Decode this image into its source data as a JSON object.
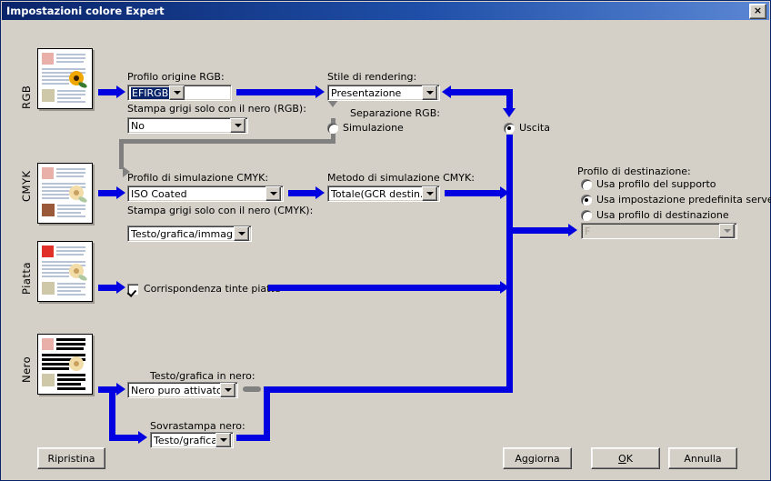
{
  "window": {
    "title": "Impostazioni colore Expert",
    "close_label": "×",
    "close_icon": "close-icon"
  },
  "sections": {
    "rgb": {
      "side_label": "RGB",
      "profile_label": "Profilo origine RGB:",
      "profile_value": "EFIRGB",
      "gray_label": "Stampa grigi solo con il nero (RGB):",
      "gray_value": "No"
    },
    "cmyk": {
      "side_label": "CMYK",
      "profile_label": "Profilo di simulazione CMYK:",
      "profile_value": "ISO Coated",
      "gray_label": "Stampa grigi solo con il nero (CMYK):",
      "gray_value": "Testo/grafica/immagini",
      "method_label": "Metodo di simulazione CMYK:",
      "method_value": "Totale(GCR destin.)"
    },
    "spot": {
      "side_label": "Piatta",
      "checkbox_label": "Corrispondenza tinte piatte",
      "checkbox_checked": true
    },
    "black": {
      "side_label": "Nero",
      "text_graphics_label": "Testo/grafica in nero:",
      "text_graphics_value": "Nero puro attivato",
      "overprint_label": "Sovrastampa nero:",
      "overprint_value": "Testo/grafica"
    }
  },
  "rendering": {
    "style_label": "Stile di rendering:",
    "style_value": "Presentazione",
    "separation_label": "Separazione RGB:",
    "simulation_label": "Simulazione",
    "simulation_selected": false,
    "output_label": "Uscita",
    "output_selected": true
  },
  "destination": {
    "title": "Profilo di destinazione:",
    "options": [
      {
        "label": "Usa profilo del supporto",
        "selected": false
      },
      {
        "label": "Usa impostazione predefinita server",
        "selected": true
      },
      {
        "label": "Usa profilo di destinazione",
        "selected": false
      }
    ],
    "profile_value": "F",
    "profile_disabled": true
  },
  "buttons": {
    "restore": "Ripristina",
    "update_pre": "A",
    "update_accel": "g",
    "update_post": "giorna",
    "ok_pre": "",
    "ok_accel": "O",
    "ok_post": "K",
    "cancel": "Annulla"
  },
  "colors": {
    "accent_blue": "#0000e0",
    "gray_connector": "#808080",
    "dialog_bg": "#d4d0c8",
    "title_bg": "#0a246a",
    "selection_bg": "#0a246a"
  }
}
